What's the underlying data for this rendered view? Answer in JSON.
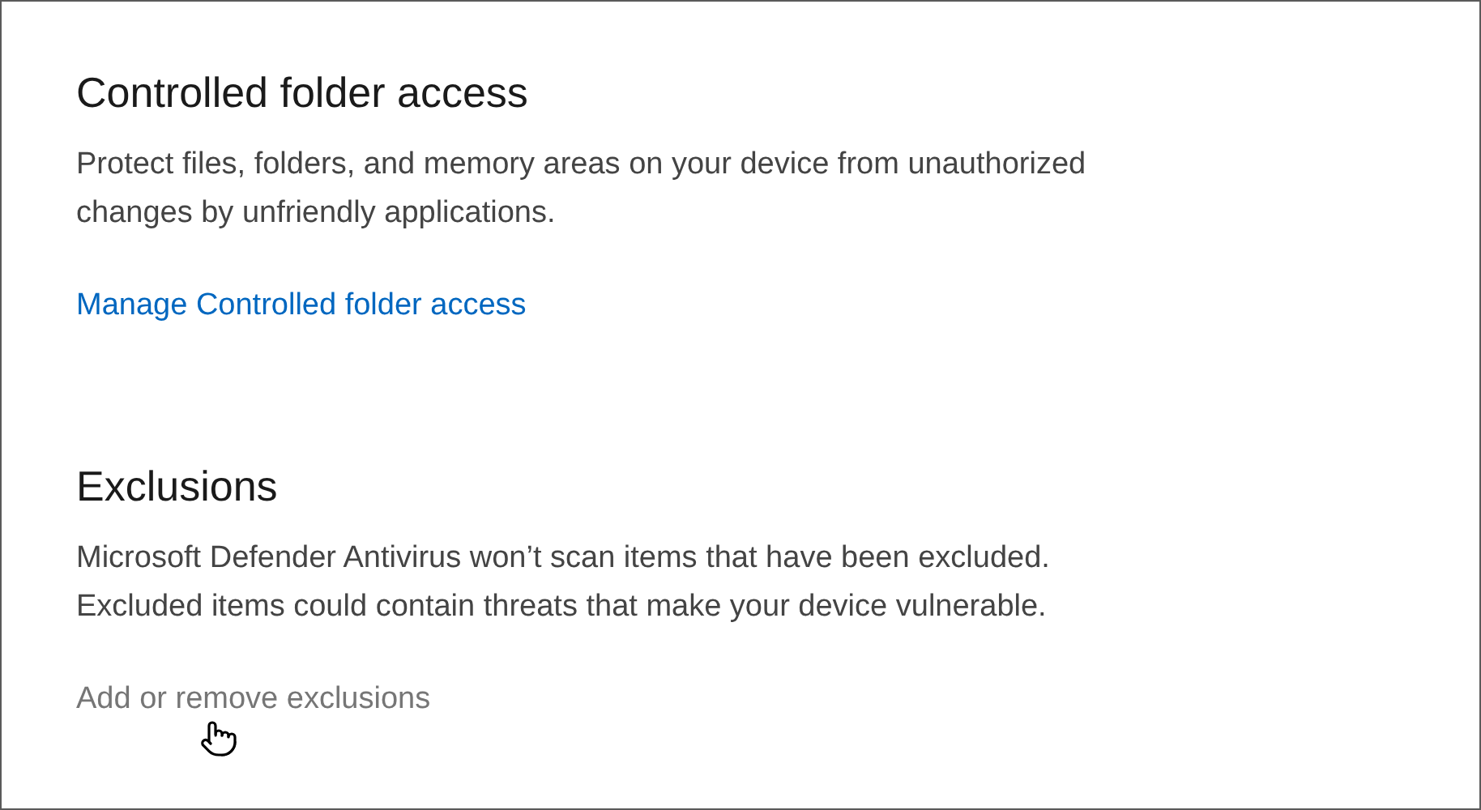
{
  "sections": [
    {
      "title": "Controlled folder access",
      "description": "Protect files, folders, and memory areas on your device from unauthorized\nchanges by unfriendly applications.",
      "link": {
        "label": "Manage Controlled folder access",
        "disabled": false
      }
    },
    {
      "title": "Exclusions",
      "description": "Microsoft Defender Antivirus won’t scan items that have been excluded.\nExcluded items could contain threats that make your device vulnerable.",
      "link": {
        "label": "Add or remove exclusions",
        "disabled": true
      }
    }
  ]
}
